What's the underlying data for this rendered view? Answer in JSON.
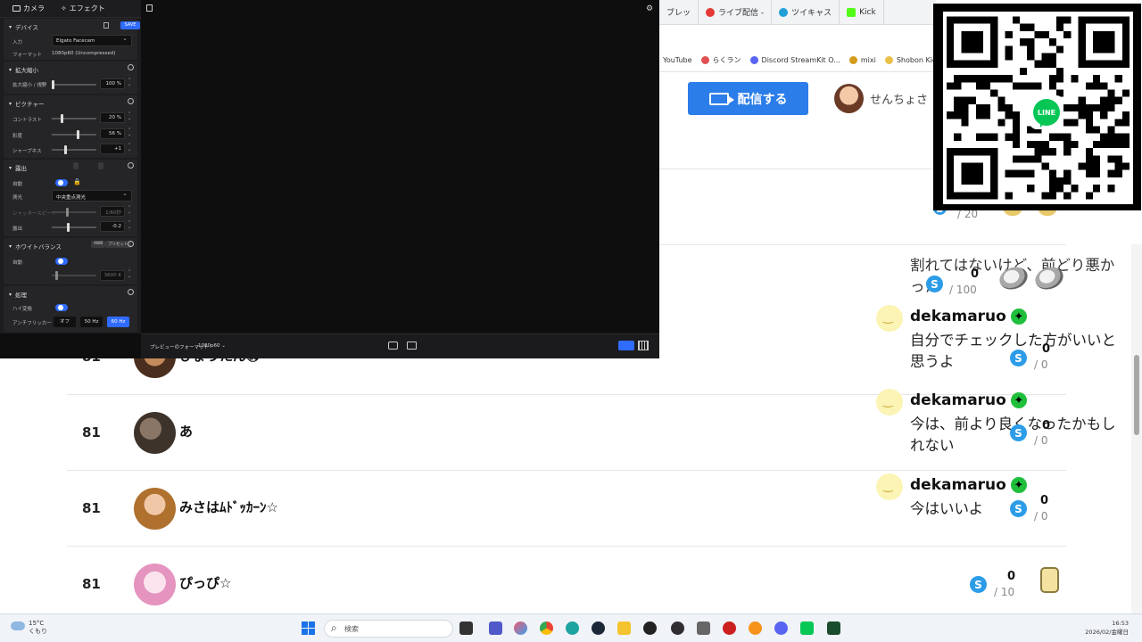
{
  "browser": {
    "tabs": [
      {
        "label": "ブレッ",
        "color": "#999999"
      },
      {
        "label": "ライブ配信 -",
        "color": "#e53935"
      },
      {
        "label": "ツイキャス",
        "color": "#21a0d8"
      },
      {
        "label": "Kick",
        "color": "#53fc18"
      }
    ],
    "bookmarks": [
      {
        "label": "YouTube",
        "color": "#ff0000"
      },
      {
        "label": "らくラン",
        "color": "#e05050"
      },
      {
        "label": "Discord StreamKit O...",
        "color": "#5865f2"
      },
      {
        "label": "mixi",
        "color": "#d39a1b"
      },
      {
        "label": "Shobon Kick Ra",
        "color": "#e8c14a"
      }
    ],
    "stream_button_label": "配信する",
    "user_name": "せんちょさ"
  },
  "camera_app": {
    "tabs": [
      "カメラ",
      "エフェクト"
    ],
    "save_label": "SAVE",
    "device_section": {
      "title": "デバイス",
      "input_label": "入力",
      "input_value": "Elgato Facecam",
      "format_label": "フォーマット",
      "format_value": "1080p60 (Uncompressed)"
    },
    "zoom_section": {
      "title": "拡大縮小",
      "param_label": "拡大縮小 / 視野",
      "value": "100 %"
    },
    "image_section": {
      "title": "ピクチャー",
      "params": [
        {
          "label": "コントラスト",
          "value": "20 %"
        },
        {
          "label": "彩度",
          "value": "56 %"
        },
        {
          "label": "シャープネス",
          "value": "+1"
        }
      ]
    },
    "exposure_section": {
      "title": "露出",
      "auto_label": "自動",
      "mode_label": "測光",
      "mode_value": "中央重点測光",
      "shutter_label": "シャッタースピード",
      "shutter_value": "1/60秒",
      "comp_label": "露出",
      "comp_value": "-0.2"
    },
    "wb_section": {
      "title": "ホワイトバランス",
      "auto_label": "自動",
      "temp_value": "3600 K",
      "btn_a": "AWB",
      "btn_b": "プリセット"
    },
    "misc_section": {
      "title": "処理",
      "hdr_label": "ハイ変換",
      "flicker_label": "アンチフリッカー",
      "options": [
        "オフ",
        "50 Hz",
        "60 Hz"
      ],
      "selected": "60 Hz"
    },
    "preview_format_label": "プレビューのフォーマット",
    "preview_format_value": "1080p60"
  },
  "ranking": [
    {
      "rank": "81",
      "name": "ひょうたん㊗",
      "avatar_color": "#8b5a2b"
    },
    {
      "rank": "81",
      "name": "あ",
      "avatar_color": "#5a4a3c"
    },
    {
      "rank": "81",
      "name": "みさはﾑﾄﾞｯｶｰﾝ☆",
      "avatar_color": "#c98a4a"
    },
    {
      "rank": "81",
      "name": "ぴっぴ☆",
      "avatar_color": "#e7a3c6"
    }
  ],
  "stats": {
    "top": {
      "den": "/ 20"
    },
    "second": {
      "num": "0",
      "den": "/ 100"
    },
    "bottom_row": {
      "num": "0",
      "den": "/ 10"
    }
  },
  "comments": [
    {
      "user": "",
      "text": "割れてはないけど、前どり悪かった"
    },
    {
      "user": "dekamaruo",
      "text": "自分でチェックした方がいいと思うよ",
      "num": "0",
      "den": "/ 0"
    },
    {
      "user": "dekamaruo",
      "text": "今は、前より良くなったかもしれない",
      "num": "0",
      "den": "/ 0"
    },
    {
      "user": "dekamaruo",
      "text": "今はいいよ",
      "num": "0",
      "den": "/ 0"
    }
  ],
  "qr": {
    "logo_text": "LINE"
  },
  "taskbar": {
    "weather_temp": "15°C",
    "weather_desc": "くもり",
    "search_placeholder": "検索",
    "time": "16:53",
    "date": "2026/02/金曜日"
  }
}
